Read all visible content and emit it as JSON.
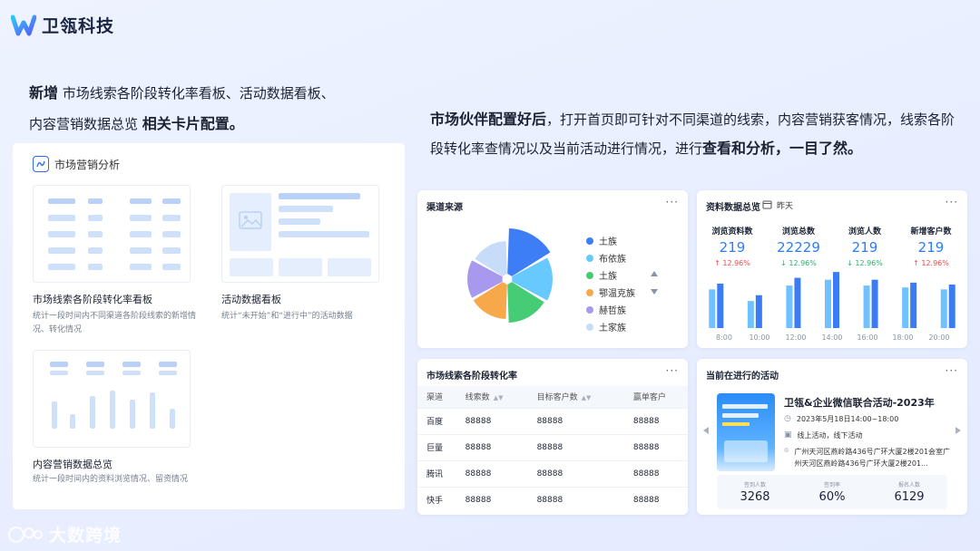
{
  "brand": {
    "name": "卫瓴科技"
  },
  "left_headline": {
    "bold1": "新增",
    "text1": " 市场线索各阶段转化率看板、活动数据看板、",
    "text2": "内容营销数据总览 ",
    "bold2": "相关卡片配置。"
  },
  "right_headline": {
    "bold1": "市场伙伴配置好后",
    "text1": "，打开首页即可针对不同渠道的线索，内容营销获客情况，线索各阶段转化率查情况以及当前活动进行情况，进行",
    "bold2": "查看和分析，一目了然。"
  },
  "left_panel": {
    "title": "市场营销分析",
    "cards": [
      {
        "name": "市场线索各阶段转化率看板",
        "desc": "统计一段时间内不同渠道各阶段线索的新增情况、转化情况"
      },
      {
        "name": "活动数据看板",
        "desc": "统计“未开始”和“进行中”的活动数据"
      },
      {
        "name": "内容营销数据总览",
        "desc": "统计一段时间内的资料浏览情况、留资情况"
      }
    ]
  },
  "channel_card": {
    "title": "渠道来源",
    "more": "···",
    "legend": [
      "土族",
      "布依族",
      "土族",
      "鄂温克族",
      "赫哲族",
      "土家族"
    ]
  },
  "overview_card": {
    "title": "资料数据总览",
    "date": "昨天",
    "more": "···",
    "stats": [
      {
        "label": "浏览资料数",
        "value": "219",
        "delta": "↑ 12.96%",
        "dir": "up"
      },
      {
        "label": "浏览总数",
        "value": "22229",
        "delta": "↓ 12.96%",
        "dir": "down"
      },
      {
        "label": "浏览人数",
        "value": "219",
        "delta": "↓ 12.96%",
        "dir": "down"
      },
      {
        "label": "新增客户数",
        "value": "219",
        "delta": "↑ 12.96%",
        "dir": "up"
      }
    ],
    "hours": [
      "8:00",
      "10:00",
      "12:00",
      "14:00",
      "16:00",
      "18:00",
      "20:00"
    ]
  },
  "chart_data": {
    "type": "bar",
    "categories": [
      "8:00",
      "10:00",
      "12:00",
      "14:00",
      "16:00",
      "18:00",
      "20:00"
    ],
    "series": [
      {
        "values": [
          40,
          28,
          44,
          50,
          44,
          42,
          40
        ]
      },
      {
        "values": [
          46,
          34,
          52,
          58,
          50,
          47,
          45
        ]
      }
    ],
    "colors": [
      "#6fc1ff",
      "#3b7cf4"
    ],
    "ylim": [
      0,
      60
    ]
  },
  "funnel_card": {
    "title": "市场线索各阶段转化率",
    "more": "···",
    "headers": [
      "渠道",
      "线索数",
      "目标客户数",
      "赢单客户"
    ],
    "rows": [
      [
        "百度",
        "88888",
        "88888",
        "88888"
      ],
      [
        "巨量",
        "88888",
        "88888",
        "88888"
      ],
      [
        "腾讯",
        "88888",
        "88888",
        "88888"
      ],
      [
        "快手",
        "88888",
        "88888",
        "88888"
      ]
    ]
  },
  "event_card": {
    "title": "当前在进行的活动",
    "more": "···",
    "event_title": "卫瓴&企业微信联合活动-2023年",
    "time": "2023年5月18日14:00~18:00",
    "mode": "线上活动，线下活动",
    "address": "广州天河区燕岭路436号广环大厦2楼201会室广州天河区燕岭路436号广环大厦2楼201...",
    "stats": [
      {
        "label": "签到人数",
        "value": "3268"
      },
      {
        "label": "签到率",
        "value": "60%"
      },
      {
        "label": "报名人数",
        "value": "6129"
      }
    ]
  },
  "watermark": {
    "text": "大数跨境"
  }
}
